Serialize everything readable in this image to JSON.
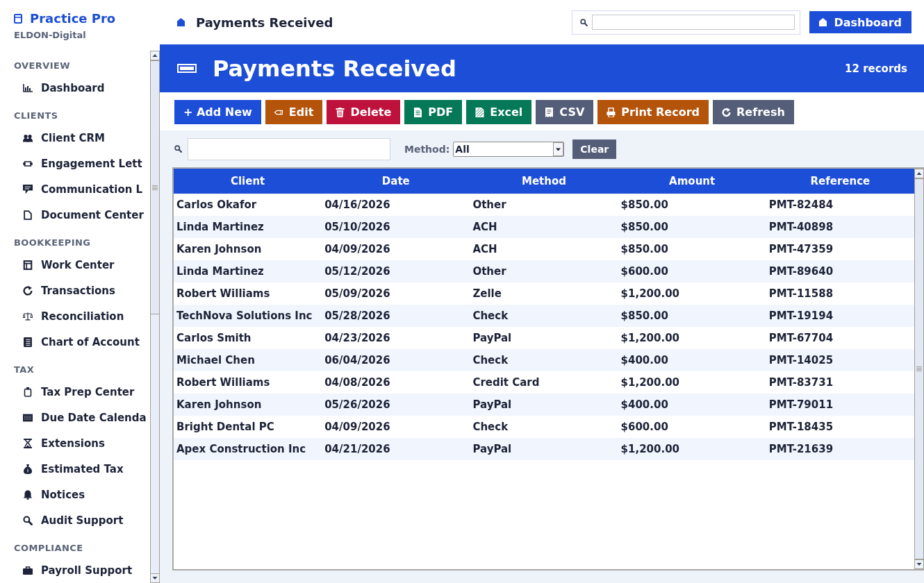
{
  "brand": {
    "name": "Practice Pro",
    "subtitle": "ELDON-Digital"
  },
  "sidebar": {
    "sections": [
      {
        "title": "OVERVIEW",
        "items": [
          "Dashboard"
        ]
      },
      {
        "title": "CLIENTS",
        "items": [
          "Client CRM",
          "Engagement Lett",
          "Communication L",
          "Document Center"
        ]
      },
      {
        "title": "BOOKKEEPING",
        "items": [
          "Work Center",
          "Transactions",
          "Reconciliation",
          "Chart of Account"
        ]
      },
      {
        "title": "TAX",
        "items": [
          "Tax Prep Center",
          "Due Date Calenda",
          "Extensions",
          "Estimated Tax",
          "Notices",
          "Audit Support"
        ]
      },
      {
        "title": "COMPLIANCE",
        "items": [
          "Payroll Support"
        ]
      }
    ]
  },
  "header": {
    "title": "Payments Received",
    "dashboard_button": "Dashboard"
  },
  "banner": {
    "title": "Payments Received",
    "record_count": "12 records"
  },
  "toolbar": [
    {
      "label": "+ Add New",
      "kind": "primary"
    },
    {
      "label": "Edit",
      "kind": "warning"
    },
    {
      "label": "Delete",
      "kind": "danger"
    },
    {
      "label": "PDF",
      "kind": "success"
    },
    {
      "label": "Excel",
      "kind": "success"
    },
    {
      "label": "CSV",
      "kind": "secondary"
    },
    {
      "label": "Print Record",
      "kind": "warning"
    },
    {
      "label": "Refresh",
      "kind": "secondary"
    }
  ],
  "filter": {
    "method_label": "Method:",
    "method_value": "All",
    "clear_button": "Clear"
  },
  "table": {
    "columns": [
      "Client",
      "Date",
      "Method",
      "Amount",
      "Reference"
    ],
    "rows": [
      [
        "Carlos Okafor",
        "04/16/2026",
        "Other",
        "$850.00",
        "PMT-82484"
      ],
      [
        "Linda Martinez",
        "05/10/2026",
        "ACH",
        "$850.00",
        "PMT-40898"
      ],
      [
        "Karen Johnson",
        "04/09/2026",
        "ACH",
        "$850.00",
        "PMT-47359"
      ],
      [
        "Linda Martinez",
        "05/12/2026",
        "Other",
        "$600.00",
        "PMT-89640"
      ],
      [
        "Robert Williams",
        "05/09/2026",
        "Zelle",
        "$1,200.00",
        "PMT-11588"
      ],
      [
        "TechNova Solutions Inc",
        "05/28/2026",
        "Check",
        "$850.00",
        "PMT-19194"
      ],
      [
        "Carlos Smith",
        "04/23/2026",
        "PayPal",
        "$1,200.00",
        "PMT-67704"
      ],
      [
        "Michael Chen",
        "06/04/2026",
        "Check",
        "$400.00",
        "PMT-14025"
      ],
      [
        "Robert Williams",
        "04/08/2026",
        "Credit Card",
        "$1,200.00",
        "PMT-83731"
      ],
      [
        "Karen Johnson",
        "05/26/2026",
        "PayPal",
        "$400.00",
        "PMT-79011"
      ],
      [
        "Bright Dental PC",
        "04/09/2026",
        "Check",
        "$600.00",
        "PMT-18435"
      ],
      [
        "Apex Construction Inc",
        "04/21/2026",
        "PayPal",
        "$1,200.00",
        "PMT-21639"
      ]
    ]
  }
}
